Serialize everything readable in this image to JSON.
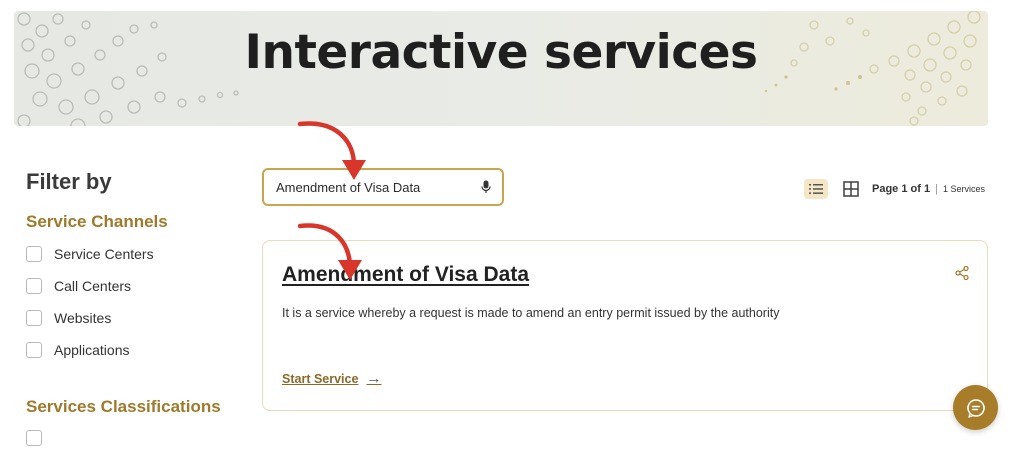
{
  "banner": {
    "title": "Interactive services"
  },
  "filter": {
    "title": "Filter by",
    "channels_title": "Service Channels",
    "channels": [
      {
        "label": "Service Centers"
      },
      {
        "label": "Call Centers"
      },
      {
        "label": "Websites"
      },
      {
        "label": "Applications"
      }
    ],
    "classifications_title": "Services Classifications"
  },
  "search": {
    "value": "Amendment of Visa Data"
  },
  "pager": {
    "page_label": "Page 1 of 1",
    "separator": "|",
    "count": "1 Services"
  },
  "card": {
    "title": "Amendment of Visa Data",
    "description": "It is a service whereby a request is made to amend an entry permit issued by the authority",
    "start_label": "Start Service",
    "start_arrow": "→"
  },
  "icons": {
    "search_mic": "mic-icon",
    "view_list": "list-view-icon",
    "view_grid": "grid-view-icon",
    "share": "share-icon",
    "chat": "chat-icon"
  },
  "colors": {
    "accent": "#c9a54e",
    "accent_dark": "#a07a2c",
    "chat_bg": "#a87d2a",
    "annotation": "#d9362b"
  }
}
